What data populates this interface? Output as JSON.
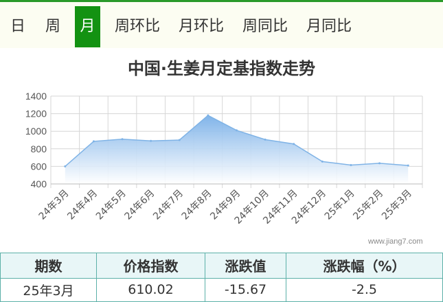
{
  "tabs": [
    {
      "label": "日",
      "active": false
    },
    {
      "label": "周",
      "active": false
    },
    {
      "label": "月",
      "active": true
    },
    {
      "label": "周环比",
      "active": false
    },
    {
      "label": "月环比",
      "active": false
    },
    {
      "label": "周同比",
      "active": false
    },
    {
      "label": "月同比",
      "active": false
    }
  ],
  "watermark": "www.jiang7.com",
  "chart_data": {
    "type": "area",
    "title": "中国·生姜月定基指数走势",
    "xlabel": "",
    "ylabel": "",
    "categories": [
      "24年3月",
      "24年4月",
      "24年5月",
      "24年6月",
      "24年7月",
      "24年8月",
      "24年9月",
      "24年10月",
      "24年11月",
      "24年12月",
      "25年1月",
      "25年2月",
      "25年3月"
    ],
    "series": [
      {
        "values": [
          600,
          885,
          910,
          890,
          900,
          1180,
          1010,
          905,
          855,
          655,
          615,
          635,
          610.02
        ]
      }
    ],
    "ylim": [
      400,
      1400
    ],
    "yticks": [
      400,
      600,
      800,
      1000,
      1200,
      1400
    ],
    "grid": true,
    "legend": "none",
    "colors": {
      "line": "#7fb3e6",
      "fill_top": "#7ab0e8",
      "fill_bottom": "#ffffff",
      "grid": "#d6d6d6"
    }
  },
  "summary": {
    "headers": [
      "期数",
      "价格指数",
      "涨跌值",
      "涨跌幅（%）"
    ],
    "row": [
      "25年3月",
      "610.02",
      "-15.67",
      "-2.5"
    ]
  },
  "colors": {
    "tab_active_bg": "#139212",
    "tab_bar_bg": "#fcfdf2",
    "table_header_bg": "#e8f6f7",
    "table_border": "#5bb0a8"
  }
}
